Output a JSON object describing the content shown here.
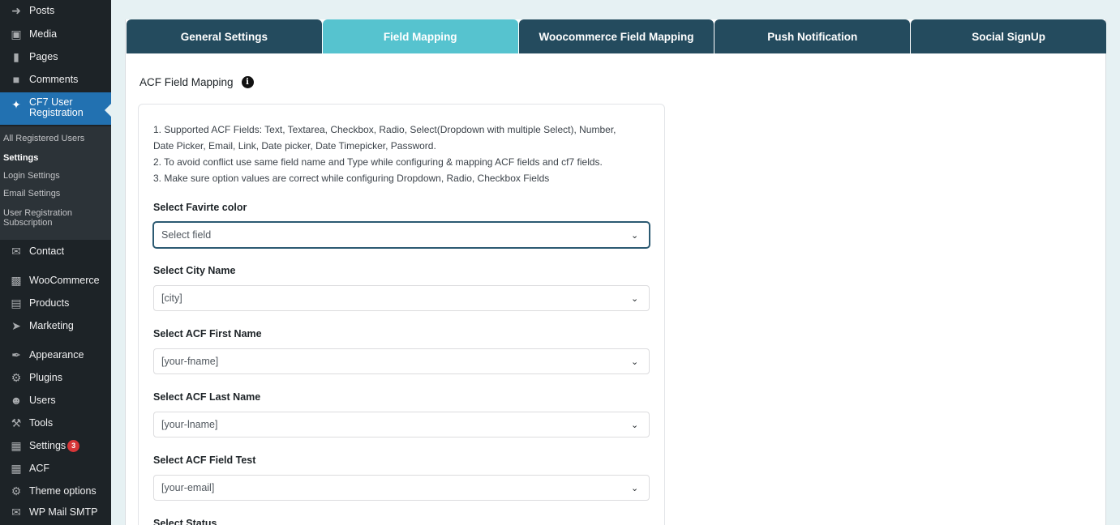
{
  "sidebar": {
    "items": [
      {
        "label": "Posts",
        "icon": "pin-icon"
      },
      {
        "label": "Media",
        "icon": "media-icon"
      },
      {
        "label": "Pages",
        "icon": "pages-icon"
      },
      {
        "label": "Comments",
        "icon": "comment-icon"
      },
      {
        "label": "CF7 User Registration",
        "label_line1": "CF7 User",
        "label_line2": "Registration",
        "icon": "cf7-icon"
      },
      {
        "label": "Contact",
        "icon": "mail-icon"
      },
      {
        "label": "WooCommerce",
        "icon": "woo-icon"
      },
      {
        "label": "Products",
        "icon": "archive-icon"
      },
      {
        "label": "Marketing",
        "icon": "megaphone-icon"
      },
      {
        "label": "Appearance",
        "icon": "brush-icon"
      },
      {
        "label": "Plugins",
        "icon": "plug-icon"
      },
      {
        "label": "Users",
        "icon": "user-icon"
      },
      {
        "label": "Tools",
        "icon": "wrench-icon"
      },
      {
        "label": "Settings",
        "icon": "settings-icon",
        "badge": "3"
      },
      {
        "label": "ACF",
        "icon": "acf-icon"
      },
      {
        "label": "Theme options",
        "icon": "gear-icon"
      },
      {
        "label": "WP Mail SMTP",
        "icon": "smtp-icon"
      }
    ],
    "submenu": [
      {
        "label": "All Registered Users"
      },
      {
        "label": "Settings"
      },
      {
        "label": "Login Settings"
      },
      {
        "label": "Email Settings"
      },
      {
        "label_line1": "User Registration",
        "label_line2": "Subscription"
      }
    ]
  },
  "tabs": [
    {
      "label": "General Settings"
    },
    {
      "label": "Field Mapping"
    },
    {
      "label": "Woocommerce Field Mapping"
    },
    {
      "label": "Push Notification"
    },
    {
      "label": "Social SignUp"
    }
  ],
  "section": {
    "title": "ACF Field Mapping",
    "info_icon": "i"
  },
  "notes": [
    "1. Supported ACF Fields: Text, Textarea, Checkbox, Radio, Select(Dropdown with multiple Select), Number,",
    "Date Picker, Email, Link, Date picker, Date Timepicker, Password.",
    "2. To avoid conflict use same field name and Type while configuring & mapping ACF fields and cf7 fields.",
    "3. Make sure option values are correct while configuring Dropdown, Radio, Checkbox Fields"
  ],
  "fields": [
    {
      "label": "Select Favirte color",
      "value": "Select field"
    },
    {
      "label": "Select City Name",
      "value": "[city]"
    },
    {
      "label": "Select ACF First Name",
      "value": "[your-fname]"
    },
    {
      "label": "Select ACF Last Name",
      "value": "[your-lname]"
    },
    {
      "label": "Select ACF Field Test",
      "value": "[your-email]"
    },
    {
      "label": "Select Status",
      "value": ""
    }
  ],
  "colors": {
    "sidebar_bg": "#1d2327",
    "active_menu": "#2271b1",
    "tab_dark": "#244b5e",
    "tab_active": "#56c3cf",
    "badge": "#d63638"
  }
}
